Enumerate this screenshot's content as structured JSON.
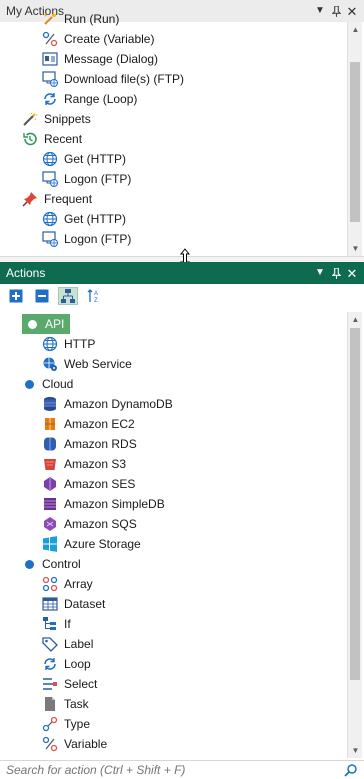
{
  "my_actions": {
    "title": "My Actions",
    "items": [
      {
        "label": "Run (Run)",
        "icon": "run-icon"
      },
      {
        "label": "Create (Variable)",
        "icon": "variable-icon"
      },
      {
        "label": "Message (Dialog)",
        "icon": "dialog-icon"
      },
      {
        "label": "Download file(s) (FTP)",
        "icon": "ftp-icon"
      },
      {
        "label": "Range (Loop)",
        "icon": "loop-icon"
      },
      {
        "label": "Snippets",
        "icon": "wand-icon"
      },
      {
        "label": "Recent",
        "icon": "history-icon"
      },
      {
        "label": "Get (HTTP)",
        "icon": "http-icon"
      },
      {
        "label": "Logon (FTP)",
        "icon": "ftp-icon"
      },
      {
        "label": "Frequent",
        "icon": "pin-icon"
      },
      {
        "label": "Get (HTTP)",
        "icon": "http-icon"
      },
      {
        "label": "Logon (FTP)",
        "icon": "ftp-icon"
      }
    ]
  },
  "actions": {
    "title": "Actions",
    "categories": [
      {
        "label": "API",
        "items": [
          "HTTP",
          "Web Service"
        ]
      },
      {
        "label": "Cloud",
        "items": [
          "Amazon DynamoDB",
          "Amazon EC2",
          "Amazon RDS",
          "Amazon S3",
          "Amazon SES",
          "Amazon SimpleDB",
          "Amazon SQS",
          "Azure Storage"
        ]
      },
      {
        "label": "Control",
        "items": [
          "Array",
          "Dataset",
          "If",
          "Label",
          "Loop",
          "Select",
          "Task",
          "Type",
          "Variable"
        ]
      }
    ]
  },
  "search": {
    "placeholder": "Search for action (Ctrl + Shift + F)"
  },
  "colors": {
    "accent": "#0e6b4f",
    "selected": "#5aaa6e",
    "bullet": "#1f6fc6"
  }
}
